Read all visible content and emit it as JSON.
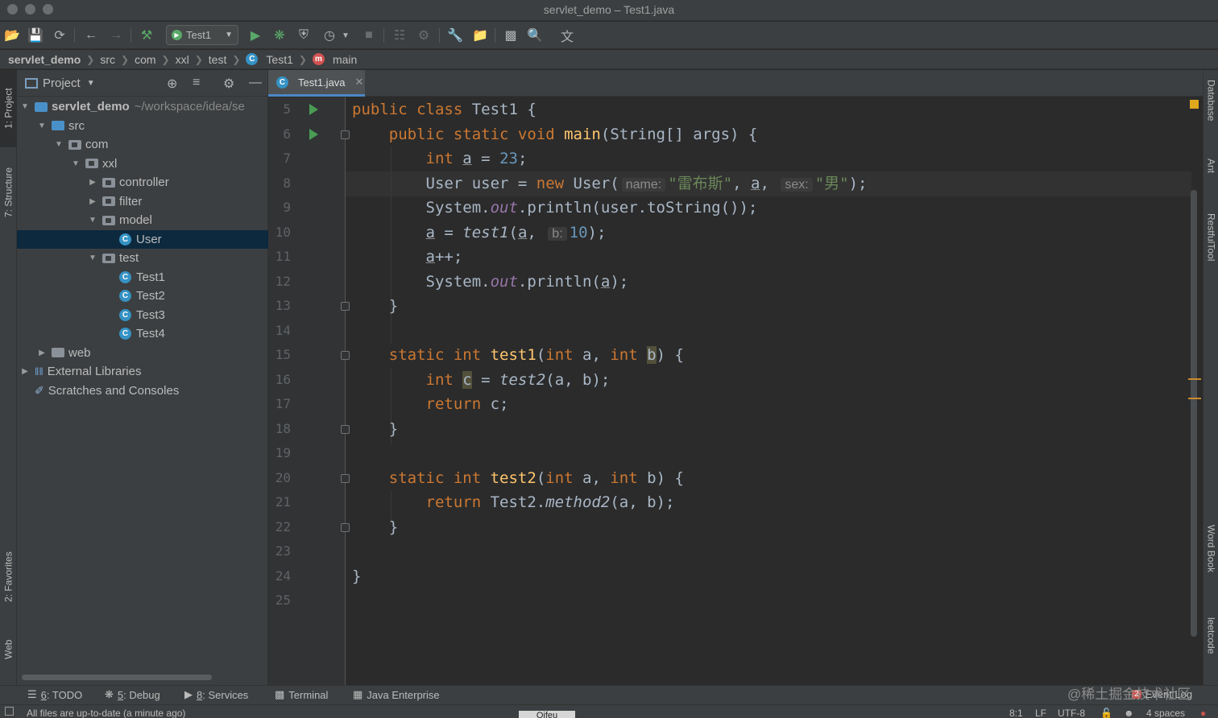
{
  "window": {
    "title": "servlet_demo – Test1.java"
  },
  "toolbar": {
    "run_config": "Test1"
  },
  "breadcrumb": [
    "servlet_demo",
    "src",
    "com",
    "xxl",
    "test",
    "Test1",
    "main"
  ],
  "project": {
    "header": "Project",
    "tree": [
      {
        "label": "servlet_demo",
        "path": "~/workspace/idea/se",
        "depth": 0,
        "arrow": "down",
        "icon": "module"
      },
      {
        "label": "src",
        "depth": 1,
        "arrow": "down",
        "icon": "folder-blue"
      },
      {
        "label": "com",
        "depth": 2,
        "arrow": "down",
        "icon": "package"
      },
      {
        "label": "xxl",
        "depth": 3,
        "arrow": "down",
        "icon": "package"
      },
      {
        "label": "controller",
        "depth": 4,
        "arrow": "right",
        "icon": "package"
      },
      {
        "label": "filter",
        "depth": 4,
        "arrow": "right",
        "icon": "package"
      },
      {
        "label": "model",
        "depth": 4,
        "arrow": "down",
        "icon": "package"
      },
      {
        "label": "User",
        "depth": 5,
        "arrow": "none",
        "icon": "class",
        "selected": true
      },
      {
        "label": "test",
        "depth": 4,
        "arrow": "down",
        "icon": "package"
      },
      {
        "label": "Test1",
        "depth": 5,
        "arrow": "none",
        "icon": "class"
      },
      {
        "label": "Test2",
        "depth": 5,
        "arrow": "none",
        "icon": "class"
      },
      {
        "label": "Test3",
        "depth": 5,
        "arrow": "none",
        "icon": "class"
      },
      {
        "label": "Test4",
        "depth": 5,
        "arrow": "none",
        "icon": "class"
      },
      {
        "label": "web",
        "depth": 1,
        "arrow": "right",
        "icon": "folder"
      },
      {
        "label": "External Libraries",
        "depth": 0,
        "arrow": "right",
        "icon": "libraries"
      },
      {
        "label": "Scratches and Consoles",
        "depth": 0,
        "arrow": "none",
        "icon": "scratches"
      }
    ]
  },
  "editor": {
    "tab": "Test1.java",
    "line_numbers": [
      "5",
      "6",
      "7",
      "8",
      "9",
      "10",
      "11",
      "12",
      "13",
      "14",
      "15",
      "16",
      "17",
      "18",
      "19",
      "20",
      "21",
      "22",
      "23",
      "24",
      "25"
    ],
    "hints": {
      "name": "name:",
      "sex": "sex:",
      "b": "b:"
    }
  },
  "left_stripe": {
    "project": "1: Project",
    "structure": "7: Structure",
    "favorites": "2: Favorites",
    "web": "Web"
  },
  "right_stripe": {
    "database": "Database",
    "ant": "Ant",
    "restful": "RestfulTool",
    "wordbook": "Word Book",
    "leetcode": "leetcode"
  },
  "bottom_tabs": {
    "todo": {
      "key": "6",
      "label": ": TODO"
    },
    "debug": {
      "key": "5",
      "label": ": Debug"
    },
    "services": {
      "key": "8",
      "label": ": Services"
    },
    "terminal": "Terminal",
    "java_enterprise": "Java Enterprise",
    "event_log": "Event Log",
    "event_count": "2"
  },
  "watermark": "@稀土掘金技术社区",
  "status": {
    "message": "All files are up-to-date (a minute ago)",
    "position": "8:1",
    "line_sep": "LF",
    "encoding": "UTF-8",
    "indent": "4 spaces",
    "center": "Oifeu"
  }
}
